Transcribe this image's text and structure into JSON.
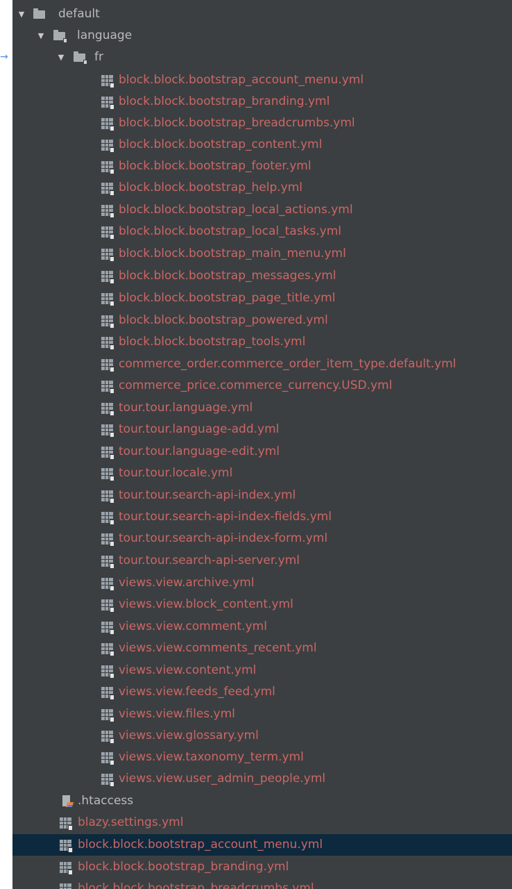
{
  "tree": {
    "root": {
      "label": "default",
      "icon": "folder-icon",
      "expanded": true
    },
    "language_folder": {
      "label": "language",
      "icon": "folder-icon",
      "expanded": true
    },
    "fr_folder": {
      "label": "fr",
      "icon": "folder-icon",
      "expanded": true
    },
    "fr_files": [
      "block.block.bootstrap_account_menu.yml",
      "block.block.bootstrap_branding.yml",
      "block.block.bootstrap_breadcrumbs.yml",
      "block.block.bootstrap_content.yml",
      "block.block.bootstrap_footer.yml",
      "block.block.bootstrap_help.yml",
      "block.block.bootstrap_local_actions.yml",
      "block.block.bootstrap_local_tasks.yml",
      "block.block.bootstrap_main_menu.yml",
      "block.block.bootstrap_messages.yml",
      "block.block.bootstrap_page_title.yml",
      "block.block.bootstrap_powered.yml",
      "block.block.bootstrap_tools.yml",
      "commerce_order.commerce_order_item_type.default.yml",
      "commerce_price.commerce_currency.USD.yml",
      "tour.tour.language.yml",
      "tour.tour.language-add.yml",
      "tour.tour.language-edit.yml",
      "tour.tour.locale.yml",
      "tour.tour.search-api-index.yml",
      "tour.tour.search-api-index-fields.yml",
      "tour.tour.search-api-index-form.yml",
      "tour.tour.search-api-server.yml",
      "views.view.archive.yml",
      "views.view.block_content.yml",
      "views.view.comment.yml",
      "views.view.comments_recent.yml",
      "views.view.content.yml",
      "views.view.feeds_feed.yml",
      "views.view.files.yml",
      "views.view.glossary.yml",
      "views.view.taxonomy_term.yml",
      "views.view.user_admin_people.yml"
    ],
    "default_files": [
      {
        "label": ".htaccess",
        "icon": "htaccess-icon",
        "selected": false
      },
      {
        "label": "blazy.settings.yml",
        "icon": "yaml-file-icon",
        "selected": false
      },
      {
        "label": "block.block.bootstrap_account_menu.yml",
        "icon": "yaml-file-icon",
        "selected": true
      },
      {
        "label": "block.block.bootstrap_branding.yml",
        "icon": "yaml-file-icon",
        "selected": false
      },
      {
        "label": "block.block.bootstrap_breadcrumbs.yml",
        "icon": "yaml-file-icon",
        "selected": false
      }
    ]
  },
  "colors": {
    "panel_background": "#3c3f41",
    "selected_row": "#0d293e",
    "modified_file_text": "#cc6666",
    "folder_text": "#bbbbbb",
    "drop_indicator": "#4a90d9"
  }
}
